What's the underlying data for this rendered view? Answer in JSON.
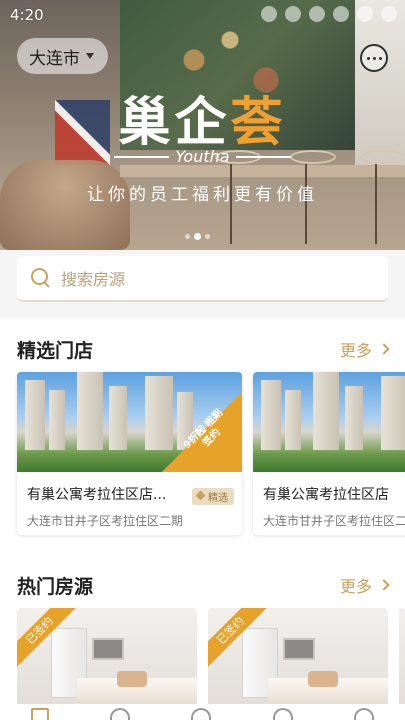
{
  "status_bar": {
    "time": "4:20"
  },
  "header": {
    "city": "大连市"
  },
  "banner": {
    "logo_main_a": "巢",
    "logo_main_b": "企",
    "logo_main_c": "荟",
    "logo_sub": "Youtha",
    "tagline": "让你的员工福利更有价值",
    "slide_count": 3,
    "active_slide": 1
  },
  "search": {
    "placeholder": "搜索房源"
  },
  "featured": {
    "title": "精选门店",
    "more": "更多",
    "cards": [
      {
        "title": "有巢公寓考拉住区店...",
        "badge": "精选",
        "address": "大连市甘井子区考拉住区二期",
        "promo": "9折起 租期签约"
      },
      {
        "title": "有巢公寓考拉住区店",
        "address": "大连市甘井子区考拉住区二期"
      }
    ]
  },
  "hot": {
    "title": "热门房源",
    "more": "更多",
    "rooms": [
      {
        "tag": "已签约"
      },
      {
        "tag": "已签约"
      },
      {
        "tag": ""
      }
    ]
  },
  "colors": {
    "accent": "#c8a25f",
    "promo": "#e7a329"
  }
}
